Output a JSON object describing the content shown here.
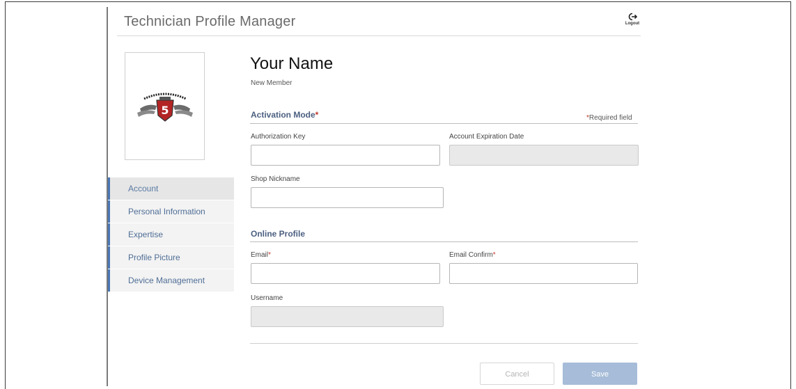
{
  "header": {
    "title": "Technician Profile Manager",
    "logout_label": "Logout"
  },
  "profile": {
    "name": "Your Name",
    "status": "New Member"
  },
  "sidebar": {
    "items": [
      {
        "label": "Account",
        "active": true
      },
      {
        "label": "Personal Information",
        "active": false
      },
      {
        "label": "Expertise",
        "active": false
      },
      {
        "label": "Profile Picture",
        "active": false
      },
      {
        "label": "Device Management",
        "active": false
      }
    ]
  },
  "activation": {
    "section_title": "Activation Mode",
    "required_note": "Required field",
    "authorization_key_label": "Authorization Key",
    "authorization_key_value": "",
    "expiration_label": "Account Expiration Date",
    "expiration_value": "",
    "shop_nickname_label": "Shop Nickname",
    "shop_nickname_value": ""
  },
  "online_profile": {
    "section_title": "Online Profile",
    "email_label": "Email",
    "email_value": "",
    "email_confirm_label": "Email Confirm",
    "email_confirm_value": "",
    "username_label": "Username",
    "username_value": ""
  },
  "actions": {
    "cancel_label": "Cancel",
    "save_label": "Save"
  },
  "colors": {
    "accent": "#4a77b5",
    "required": "#c0392b",
    "save_button": "#a6bcd8"
  },
  "icons": {
    "logout": "logout-icon",
    "avatar": "team-logo"
  }
}
